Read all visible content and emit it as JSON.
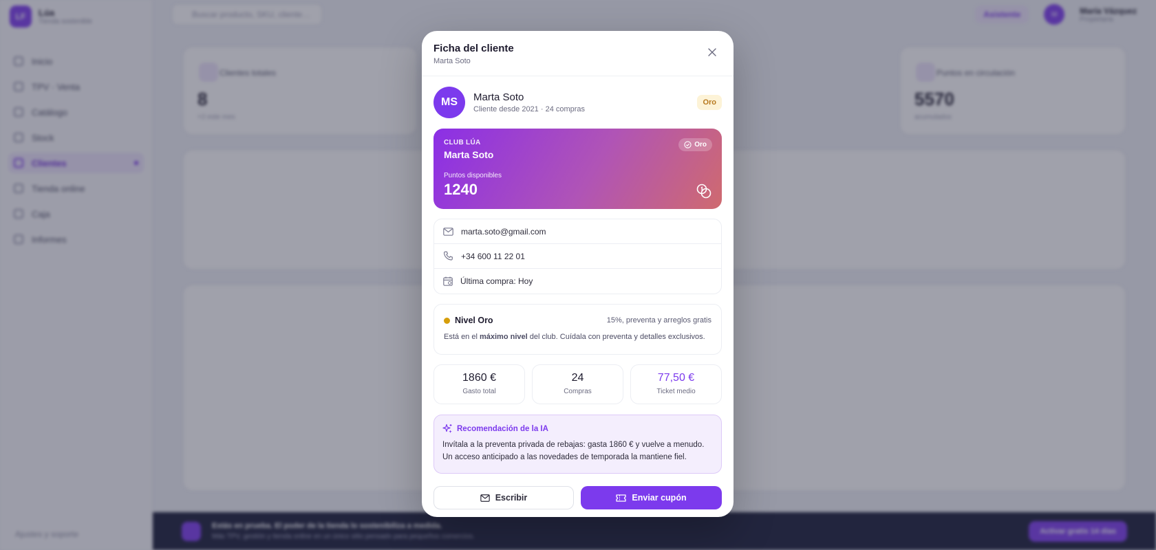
{
  "bg": {
    "brand": {
      "initials": "LF",
      "name": "Lúa",
      "sub": "Tienda sostenible"
    },
    "nav": [
      {
        "label": "Inicio"
      },
      {
        "label": "TPV · Venta"
      },
      {
        "label": "Catálogo"
      },
      {
        "label": "Stock"
      },
      {
        "label": "Clientes"
      },
      {
        "label": "Tienda online"
      },
      {
        "label": "Caja"
      },
      {
        "label": "Informes"
      }
    ],
    "sidebar_footer": "Ajustes y soporte",
    "search_placeholder": "Buscar producto, SKU, cliente…",
    "assistant_label": "Asistente",
    "user": {
      "initials": "M",
      "name": "María Vázquez",
      "role": "Propietaria"
    },
    "kpis": [
      {
        "title": "Clientes totales",
        "value": "8",
        "sub": "+2 este mes"
      },
      {
        "title": "Puntos en circulación",
        "value": "5570",
        "sub": "acumulados"
      }
    ],
    "banner": {
      "title": "Estás en prueba. El poder de la tienda lo sostenibiliza a medida.",
      "sub": "Más TPV, gestión y tienda online en un único sitio pensado para pequeños comercios.",
      "button": "Activar gratis 14 días"
    }
  },
  "modal": {
    "title": "Ficha del cliente",
    "subtitle": "Marta Soto",
    "customer": {
      "initials": "MS",
      "name": "Marta Soto",
      "since": "Cliente desde 2021 · 24 compras",
      "tier": "Oro"
    },
    "club": {
      "label": "CLUB LÚA",
      "name": "Marta Soto",
      "badge": "Oro",
      "points_label": "Puntos disponibles",
      "points": "1240"
    },
    "contact": {
      "email": "marta.soto@gmail.com",
      "phone": "+34 600 11 22 01",
      "last_purchase": "Última compra: Hoy"
    },
    "level": {
      "name": "Nivel Oro",
      "perks": "15%, preventa y arreglos gratis",
      "desc_pre": "Está en el ",
      "desc_bold": "máximo nivel",
      "desc_post": " del club. Cuídala con preventa y detalles exclusivos."
    },
    "stats": [
      {
        "value": "1860 €",
        "label": "Gasto total"
      },
      {
        "value": "24",
        "label": "Compras"
      },
      {
        "value": "77,50 €",
        "label": "Ticket medio"
      }
    ],
    "ai": {
      "title": "Recomendación de la IA",
      "body": "Invítala a la preventa privada de rebajas: gasta 1860 € y vuelve a menudo. Un acceso anticipado a las novedades de temporada la mantiene fiel."
    },
    "actions": {
      "write": "Escribir",
      "coupon": "Enviar cupón"
    },
    "colors": {
      "accent": "#7c3aed",
      "gold": "#d69e0a"
    }
  }
}
